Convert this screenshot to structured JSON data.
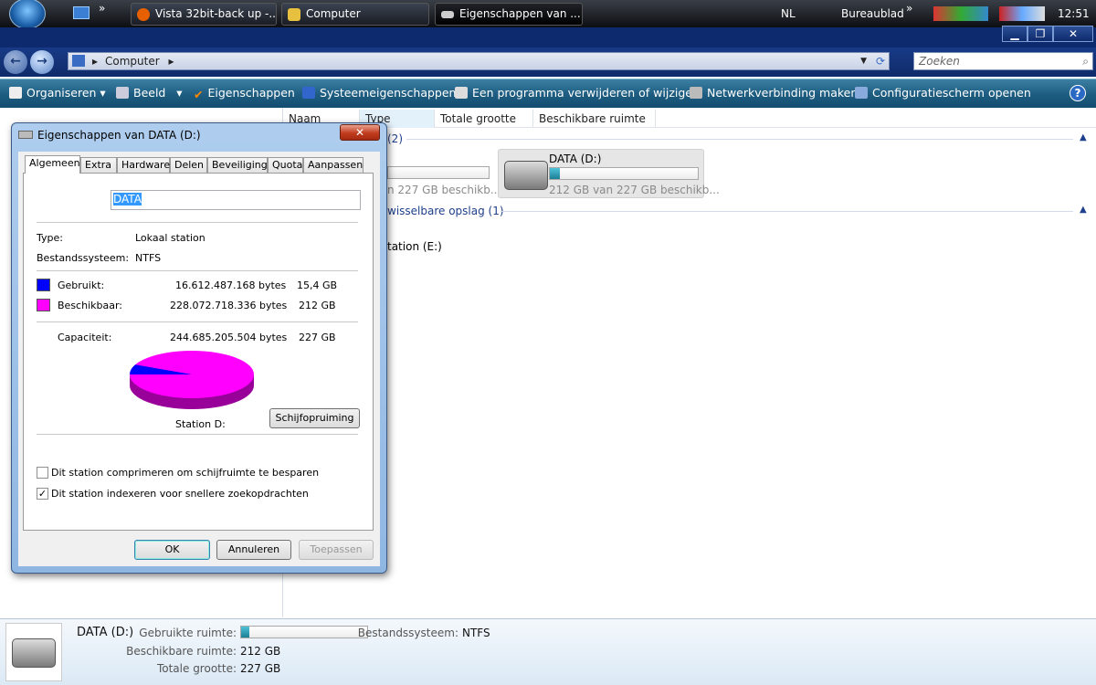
{
  "taskbar": {
    "buttons": [
      {
        "label": "Vista 32bit-back up -...",
        "icon": "firefox-icon"
      },
      {
        "label": "Computer",
        "icon": "folder-icon"
      },
      {
        "label": "Eigenschappen van ...",
        "icon": "drive-icon"
      }
    ],
    "language": "NL",
    "desktop": "Bureaublad",
    "time": "12:51",
    "chevrons": "»"
  },
  "window": {
    "minimize": "▁",
    "restore": "❐",
    "close": "✕"
  },
  "address": {
    "path": "Computer",
    "separator": "▸",
    "search_placeholder": "Zoeken"
  },
  "toolbar": {
    "items": [
      "Organiseren",
      "Beeld",
      "Eigenschappen",
      "Systeemeigenschappen",
      "Een programma verwijderen of wijzigen",
      "Netwerkverbinding maken",
      "Configuratiescherm openen"
    ],
    "help": "?"
  },
  "columns": [
    "Naam",
    "Type",
    "Totale grootte",
    "Beschikbare ruimte"
  ],
  "content": {
    "group1_count": "(2)",
    "group2": "wisselbare opslag (1)",
    "drive_c_partial": "n 227 GB beschikb...",
    "drive_d": {
      "name": "DATA (D:)",
      "free_text": "212 GB van 227 GB beschikb...",
      "used_fraction": 0.068
    },
    "drive_e_partial": "tation (E:)"
  },
  "dialog": {
    "title": "Eigenschappen van DATA (D:)",
    "close": "✕",
    "tabs": [
      "Algemeen",
      "Extra",
      "Hardware",
      "Delen",
      "Beveiliging",
      "Quota",
      "Aanpassen"
    ],
    "name_value": "DATA",
    "type_label": "Type:",
    "type_value": "Lokaal station",
    "fs_label": "Bestandssysteem:",
    "fs_value": "NTFS",
    "used_label": "Gebruikt:",
    "used_bytes": "16.612.487.168 bytes",
    "used_gb": "15,4 GB",
    "free_label": "Beschikbaar:",
    "free_bytes": "228.072.718.336 bytes",
    "free_gb": "212 GB",
    "cap_label": "Capaciteit:",
    "cap_bytes": "244.685.205.504 bytes",
    "cap_gb": "227 GB",
    "used_color": "#0000ff",
    "free_color": "#ff00ff",
    "used_fraction": 0.068,
    "station_label": "Station D:",
    "cleanup": "Schijfopruiming",
    "compress": "Dit station comprimeren om schijfruimte te besparen",
    "compress_checked": false,
    "index": "Dit station indexeren voor snellere zoekopdrachten",
    "index_checked": true,
    "ok": "OK",
    "cancel": "Annuleren",
    "apply": "Toepassen"
  },
  "details": {
    "name": "DATA (D:)",
    "used_label": "Gebruikte ruimte:",
    "fs_label": "Bestandssysteem:",
    "fs_value": "NTFS",
    "free_label": "Beschikbare ruimte:",
    "free_value": "212 GB",
    "total_label": "Totale grootte:",
    "total_value": "227 GB",
    "used_fraction": 0.068
  }
}
